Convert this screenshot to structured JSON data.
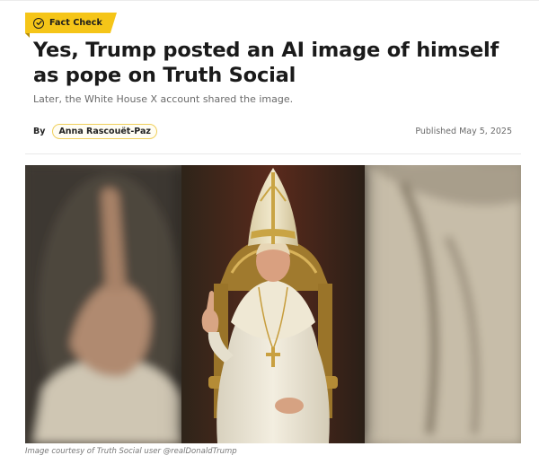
{
  "badge": {
    "label": "Fact Check",
    "icon": "check-circle-icon",
    "color": "#f5c518"
  },
  "article": {
    "headline": "Yes, Trump posted an AI image of himself as pope on Truth Social",
    "subtitle": "Later, the White House X account shared the image.",
    "by_label": "By",
    "author": "Anna Rascouët-Paz",
    "published": "Published May 5, 2025"
  },
  "image": {
    "caption": "Image courtesy of Truth Social user @realDonaldTrump"
  }
}
